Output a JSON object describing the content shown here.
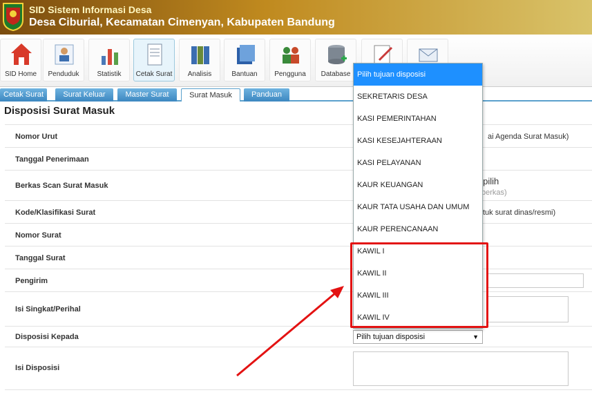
{
  "header": {
    "title": "SID Sistem Informasi Desa",
    "subtitle": "Desa Ciburial, Kecamatan Cimenyan, Kabupaten Bandung"
  },
  "toolbar": {
    "items": [
      {
        "label": "SID Home",
        "icon": "house-icon"
      },
      {
        "label": "Penduduk",
        "icon": "people-icon"
      },
      {
        "label": "Statistik",
        "icon": "chart-icon"
      },
      {
        "label": "Cetak Surat",
        "icon": "document-icon",
        "active": true
      },
      {
        "label": "Analisis",
        "icon": "binders-icon"
      },
      {
        "label": "Bantuan",
        "icon": "books-icon"
      },
      {
        "label": "Pengguna",
        "icon": "users-icon"
      },
      {
        "label": "Database",
        "icon": "database-icon"
      },
      {
        "label": "",
        "icon": "settings-icon"
      },
      {
        "label": "",
        "icon": "mail-icon"
      }
    ]
  },
  "subtabs": [
    {
      "label": "Cetak Surat"
    },
    {
      "label": "Surat Keluar"
    },
    {
      "label": "Master Surat"
    },
    {
      "label": "Surat Masuk",
      "active": true
    },
    {
      "label": "Panduan"
    }
  ],
  "page_title": "Disposisi Surat Masuk",
  "form": {
    "fields": [
      {
        "label": "Nomor Urut"
      },
      {
        "label": "Tanggal Penerimaan"
      },
      {
        "label": "Berkas Scan Surat Masuk"
      },
      {
        "label": "Kode/Klasifikasi Surat"
      },
      {
        "label": "Nomor Surat"
      },
      {
        "label": "Tanggal Surat"
      },
      {
        "label": "Pengirim"
      },
      {
        "label": "Isi Singkat/Perihal"
      },
      {
        "label": "Disposisi Kepada"
      },
      {
        "label": "Isi Disposisi"
      }
    ],
    "notes": {
      "nomor_urut": "ai Agenda Surat Masuk)",
      "berkas_main": "dipilih",
      "berkas_sub": "berkas)",
      "kode": "tuk surat dinas/resmi)"
    },
    "disposisi_select": "Pilih tujuan disposisi"
  },
  "dropdown": {
    "options": [
      "Pilih tujuan disposisi",
      "SEKRETARIS DESA",
      "KASI PEMERINTAHAN",
      "KASI KESEJAHTERAAN",
      "KASI PELAYANAN",
      "KAUR KEUANGAN",
      "KAUR TATA USAHA DAN UMUM",
      "KAUR PERENCANAAN",
      "KAWIL I",
      "KAWIL II",
      "KAWIL III",
      "KAWIL IV"
    ],
    "selected_index": 0
  },
  "colors": {
    "header_start": "#7a4b0e",
    "header_end": "#d9c36a",
    "tab_blue": "#3c87c0",
    "selected_option": "#1e90ff",
    "annotation_red": "#e31212"
  }
}
